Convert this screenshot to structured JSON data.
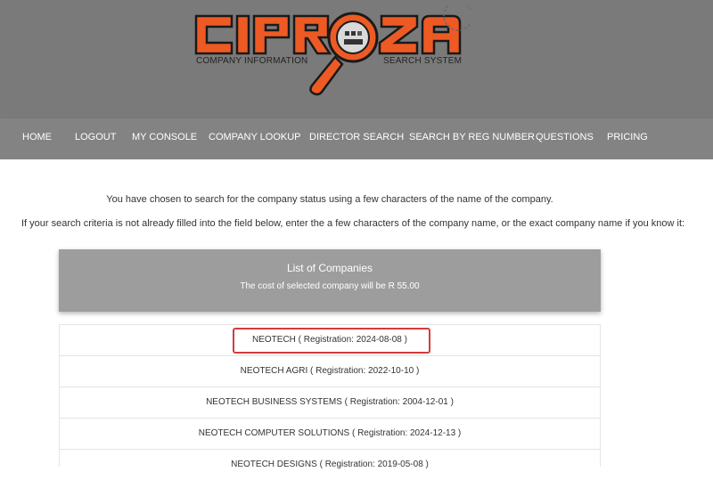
{
  "logo": {
    "text": "CIPROZA",
    "subtitle_left": "COMPANY INFORMATION",
    "subtitle_right": "SEARCH SYSTEM",
    "colors": {
      "letters": "#ee5a24",
      "outline": "#1a1a1a"
    }
  },
  "nav": {
    "items": [
      {
        "label": "HOME"
      },
      {
        "label": "LOGOUT"
      },
      {
        "label": "MY CONSOLE"
      },
      {
        "label": "COMPANY LOOKUP"
      },
      {
        "label": "DIRECTOR SEARCH"
      },
      {
        "label": "SEARCH BY REG NUMBER"
      },
      {
        "label": "QUESTIONS"
      },
      {
        "label": "PRICING"
      }
    ]
  },
  "main": {
    "intro1": "You have chosen to search for the company status using a few characters of the name of the company.",
    "intro2": "If your search criteria is not already filled into the field below, enter the a few characters of the company name, or the exact company name if you know it:",
    "panel": {
      "title": "List of Companies",
      "cost": "The cost of selected company will be R 55.00"
    },
    "companies": [
      {
        "label": "NEOTECH ( Registration: 2024-08-08 )",
        "highlighted": true
      },
      {
        "label": "NEOTECH AGRI ( Registration: 2022-10-10 )"
      },
      {
        "label": "NEOTECH BUSINESS SYSTEMS ( Registration: 2004-12-01 )"
      },
      {
        "label": "NEOTECH COMPUTER SOLUTIONS ( Registration: 2024-12-13 )"
      },
      {
        "label": "NEOTECH DESIGNS ( Registration: 2019-05-08 )"
      }
    ]
  },
  "colors": {
    "header_bg": "#7a7a7a",
    "nav_bg": "#838383",
    "panel_bg": "#9d9d9d",
    "highlight": "#d23c3c"
  }
}
